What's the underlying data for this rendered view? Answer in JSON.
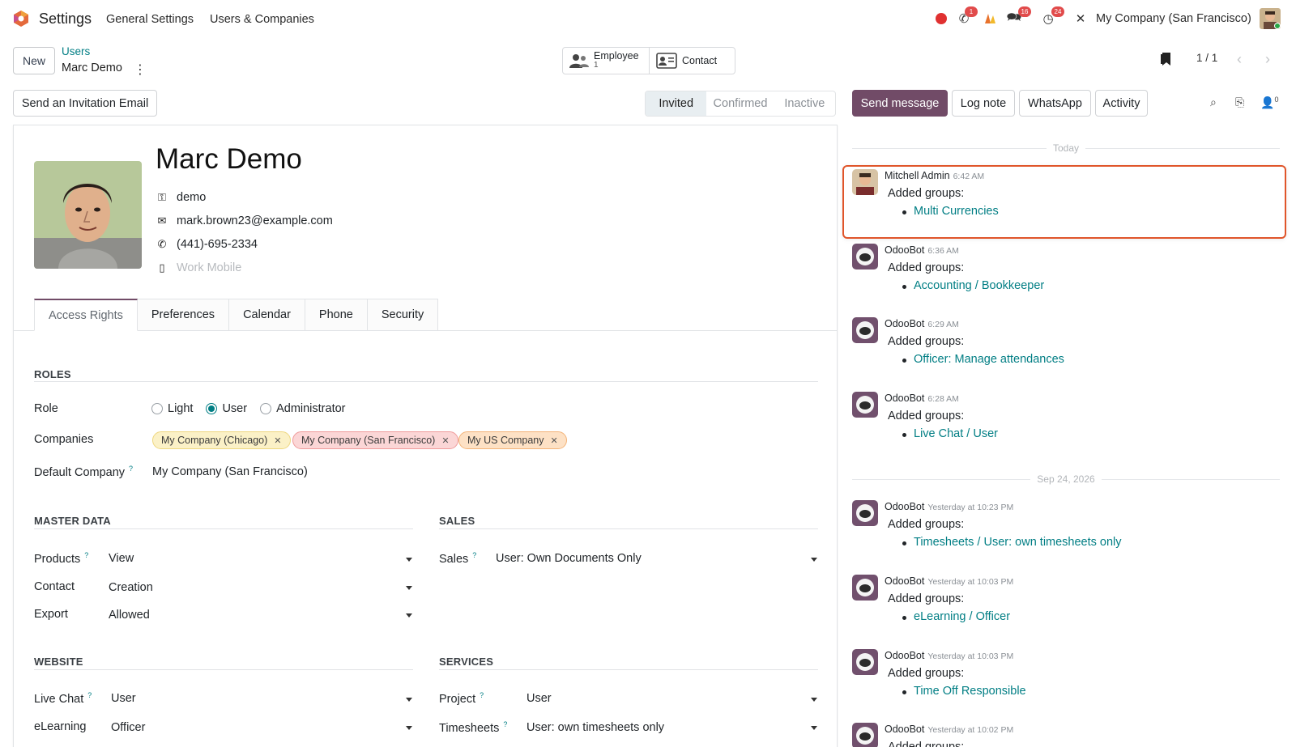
{
  "navbar": {
    "app_name": "Settings",
    "links": [
      "General Settings",
      "Users & Companies"
    ],
    "badges": {
      "phone": "1",
      "messages": "16",
      "activities": "24"
    },
    "company": "My Company (San Francisco)"
  },
  "control": {
    "new_label": "New",
    "breadcrumb_parent": "Users",
    "breadcrumb_current": "Marc Demo",
    "smart_employee_label": "Employee",
    "smart_employee_count": "1",
    "smart_contact_label": "Contact",
    "pager": "1 / 1"
  },
  "actions": {
    "invite_label": "Send an Invitation Email",
    "statuses": [
      "Invited",
      "Confirmed",
      "Inactive"
    ],
    "active_status": "Invited"
  },
  "user": {
    "name": "Marc Demo",
    "login": "demo",
    "email": "mark.brown23@example.com",
    "phone": "(441)-695-2334",
    "mobile_placeholder": "Work Mobile"
  },
  "tabs": [
    "Access Rights",
    "Preferences",
    "Calendar",
    "Phone",
    "Security"
  ],
  "roles": {
    "title": "ROLES",
    "role_label": "Role",
    "options": [
      "Light",
      "User",
      "Administrator"
    ],
    "selected": "User",
    "companies_label": "Companies",
    "companies": [
      "My Company (Chicago)",
      "My Company (San Francisco)",
      "My US Company"
    ],
    "default_company_label": "Default Company",
    "default_company": "My Company (San Francisco)"
  },
  "master_data": {
    "title": "MASTER DATA",
    "fields": [
      {
        "label": "Products",
        "value": "View"
      },
      {
        "label": "Contact",
        "value": "Creation"
      },
      {
        "label": "Export",
        "value": "Allowed"
      }
    ]
  },
  "sales": {
    "title": "SALES",
    "fields": [
      {
        "label": "Sales",
        "value": "User: Own Documents Only"
      }
    ]
  },
  "website": {
    "title": "WEBSITE",
    "fields": [
      {
        "label": "Live Chat",
        "value": "User"
      },
      {
        "label": "eLearning",
        "value": "Officer"
      }
    ]
  },
  "services": {
    "title": "SERVICES",
    "fields": [
      {
        "label": "Project",
        "value": "User"
      },
      {
        "label": "Timesheets",
        "value": "User: own timesheets only"
      }
    ]
  },
  "chatter": {
    "buttons": [
      "Send message",
      "Log note",
      "WhatsApp",
      "Activity"
    ],
    "followers_count": "0",
    "date_today": "Today",
    "date_past": "Sep 24, 2026",
    "messages": [
      {
        "author": "Mitchell Admin",
        "time": "6:42 AM",
        "text": "Added groups:",
        "item": "Multi Currencies"
      },
      {
        "author": "OdooBot",
        "time": "6:36 AM",
        "text": "Added groups:",
        "item": "Accounting / Bookkeeper"
      },
      {
        "author": "OdooBot",
        "time": "6:29 AM",
        "text": "Added groups:",
        "item": "Officer: Manage attendances"
      },
      {
        "author": "OdooBot",
        "time": "6:28 AM",
        "text": "Added groups:",
        "item": "Live Chat / User"
      },
      {
        "author": "OdooBot",
        "time": "Yesterday at 10:23 PM",
        "text": "Added groups:",
        "item": "Timesheets / User: own timesheets only"
      },
      {
        "author": "OdooBot",
        "time": "Yesterday at 10:03 PM",
        "text": "Added groups:",
        "item": "eLearning / Officer"
      },
      {
        "author": "OdooBot",
        "time": "Yesterday at 10:03 PM",
        "text": "Added groups:",
        "item": "Time Off Responsible"
      },
      {
        "author": "OdooBot",
        "time": "Yesterday at 10:02 PM",
        "text": "Added groups:",
        "item": ""
      }
    ]
  },
  "colors": {
    "brand": "#714b67",
    "link": "#017e84",
    "highlight": "#e0552a"
  }
}
